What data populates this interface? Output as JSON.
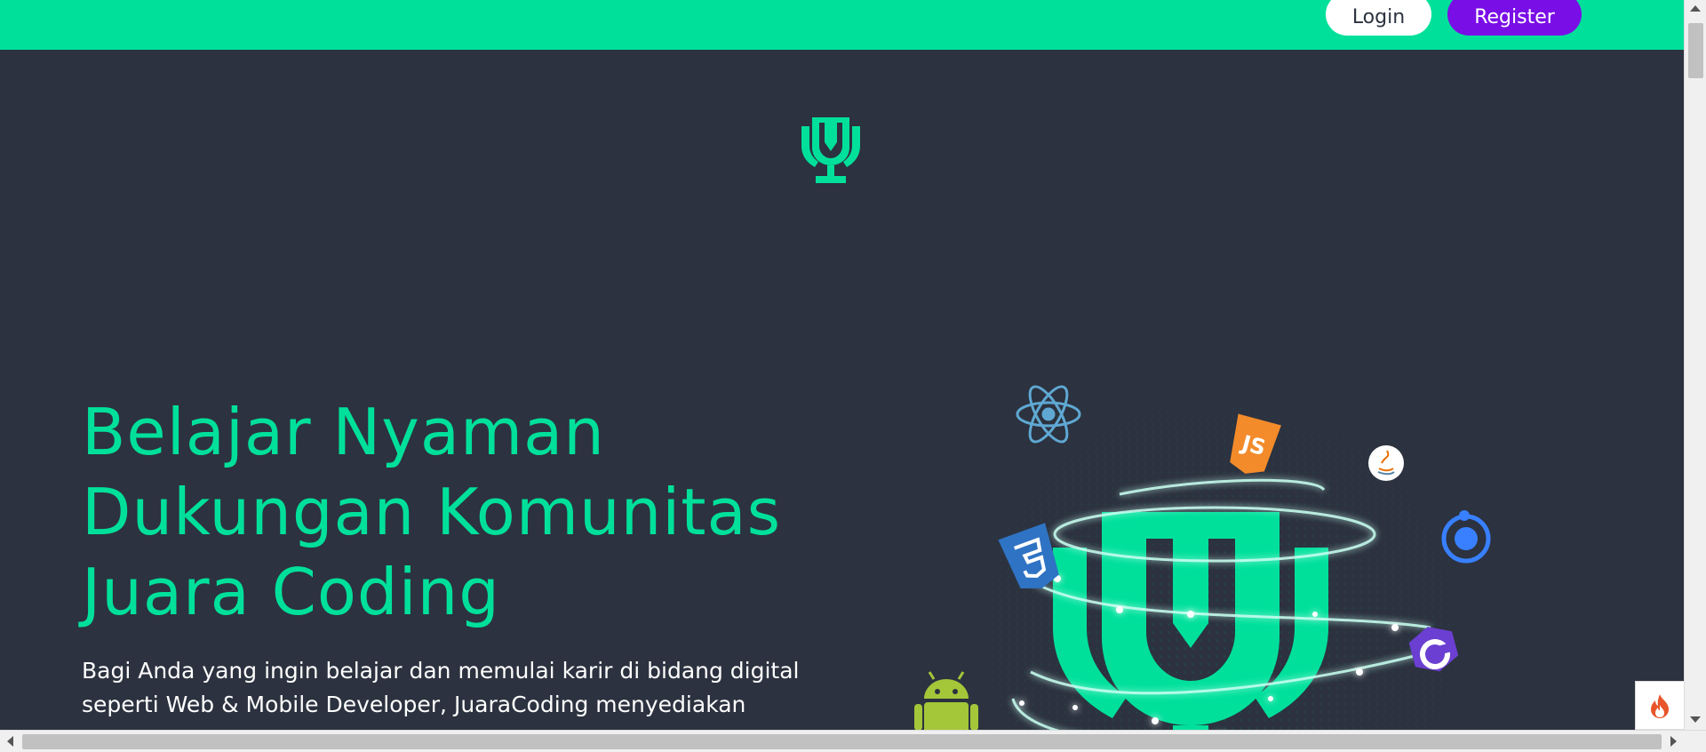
{
  "header": {
    "login_label": "Login",
    "register_label": "Register"
  },
  "hero": {
    "title_lines": [
      "Belajar Nyaman",
      "Dukungan Komunitas",
      "Juara Coding"
    ],
    "subtitle_lines": [
      "Bagi Anda yang ingin belajar dan memulai karir di bidang digital",
      "seperti Web & Mobile Developer, JuaraCoding menyediakan"
    ]
  },
  "colors": {
    "accent": "#00e09b",
    "register": "#7a0ee6",
    "background": "#2c323f"
  },
  "icons": [
    "trophy-logo-icon",
    "react-icon",
    "javascript-icon",
    "java-icon",
    "css3-icon",
    "ionic-icon",
    "codeigniter-icon",
    "android-icon",
    "html5-icon",
    "fire-icon"
  ]
}
